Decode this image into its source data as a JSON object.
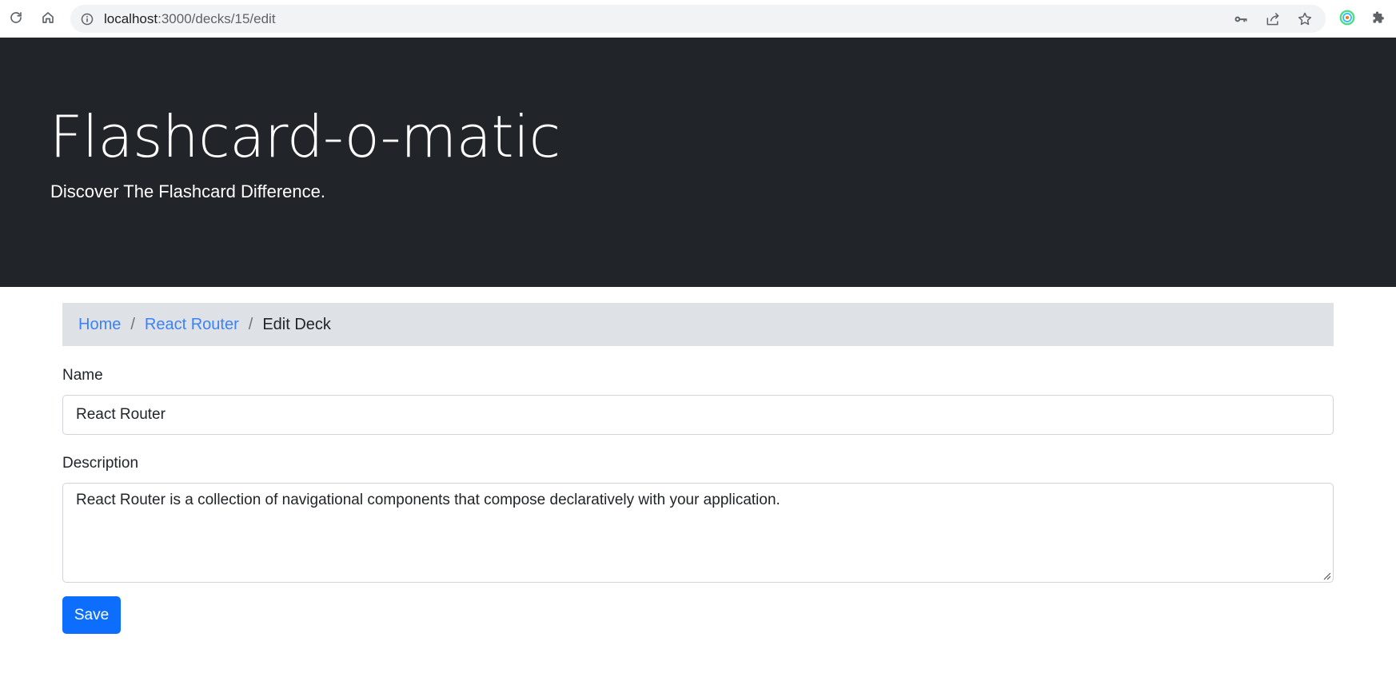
{
  "browser": {
    "url_host": "localhost",
    "url_rest": ":3000/decks/15/edit",
    "icons": [
      "reload-icon",
      "home-icon",
      "info-icon",
      "key-icon",
      "share-icon",
      "star-icon",
      "extension-profile-icon",
      "puzzle-icon"
    ]
  },
  "header": {
    "title": "Flashcard-o-matic",
    "subtitle": "Discover The Flashcard Difference."
  },
  "breadcrumb": {
    "home": "Home",
    "deck": "React Router",
    "separator": "/",
    "current": "Edit Deck"
  },
  "form": {
    "name_label": "Name",
    "name_value": "React Router",
    "description_label": "Description",
    "description_value": "React Router is a collection of navigational components that compose declaratively with your application.",
    "save_label": "Save"
  },
  "colors": {
    "header_bg": "#212529",
    "breadcrumb_bg": "#dee2e6",
    "link": "#3b82f6",
    "primary_button": "#0d6efd"
  }
}
